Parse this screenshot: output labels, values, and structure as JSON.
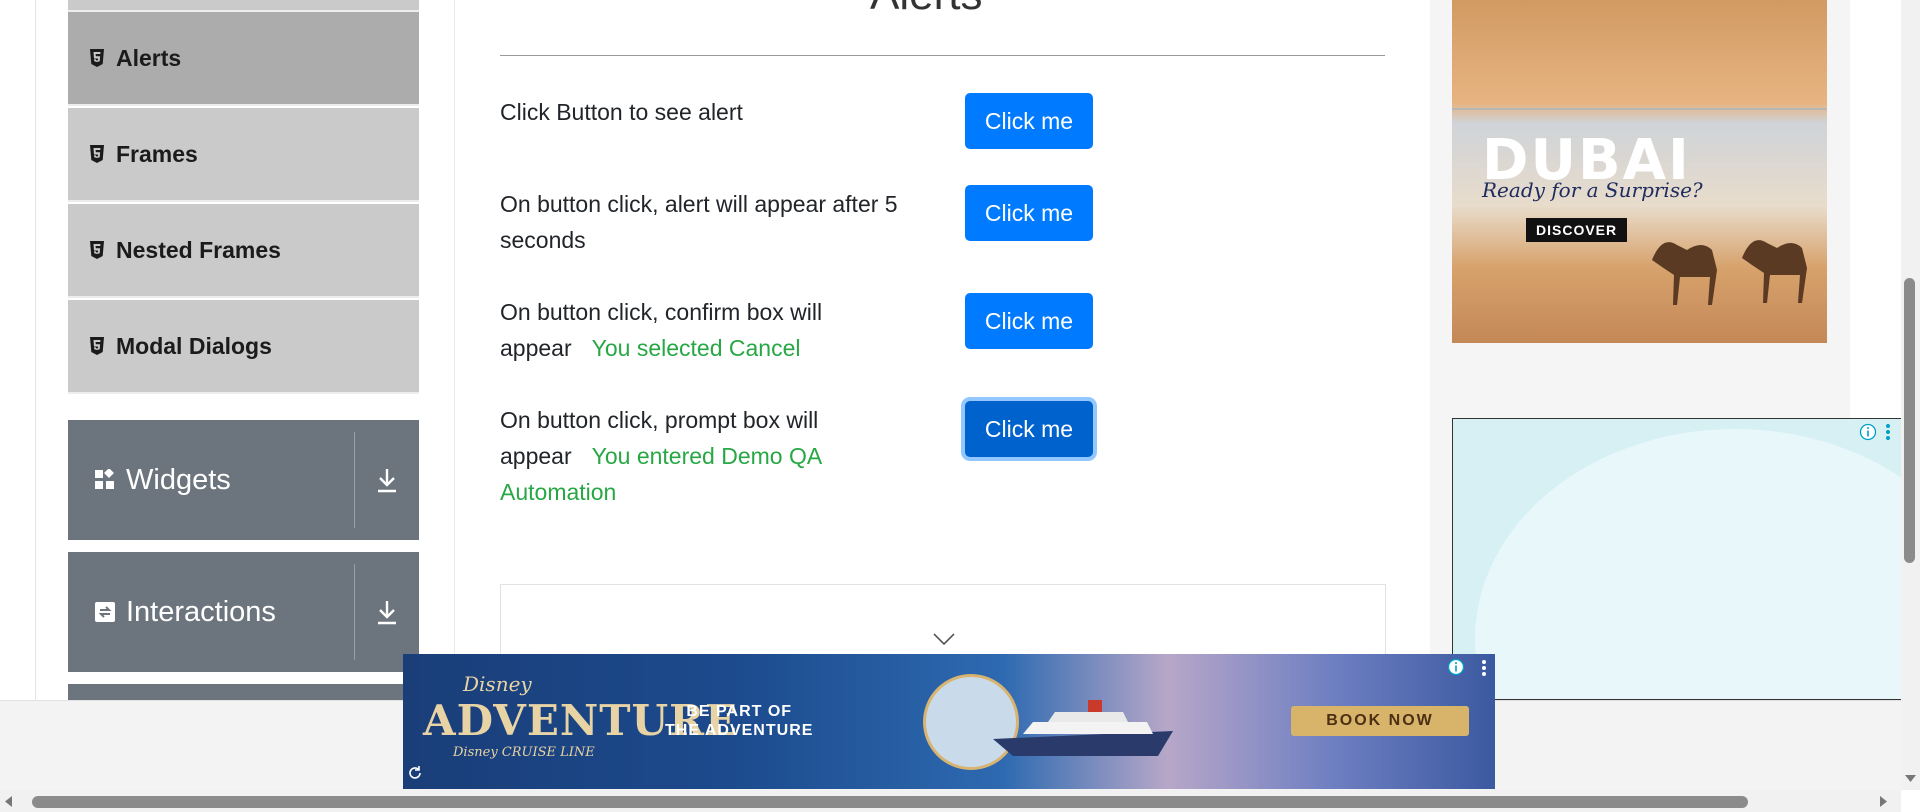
{
  "sidebar": {
    "items": [
      {
        "label": "Alerts",
        "active": true
      },
      {
        "label": "Frames",
        "active": false
      },
      {
        "label": "Nested Frames",
        "active": false
      },
      {
        "label": "Modal Dialogs",
        "active": false
      }
    ],
    "groups": [
      {
        "label": "Widgets",
        "icon": "widgets-icon"
      },
      {
        "label": "Interactions",
        "icon": "interactions-icon"
      }
    ]
  },
  "main": {
    "title": "Alerts",
    "rows": [
      {
        "text": "Click Button to see alert",
        "result": "",
        "button": "Click me"
      },
      {
        "text": "On button click, alert will appear after 5 seconds",
        "result": "",
        "button": "Click me"
      },
      {
        "text": "On button click, confirm box will appear",
        "result": "You selected Cancel",
        "button": "Click me"
      },
      {
        "text": "On button click, prompt box will appear",
        "result": "You entered Demo QA Automation",
        "button": "Click me"
      }
    ]
  },
  "ads": {
    "right_top": {
      "headline": "DUBAI",
      "tagline": "Ready for a Surprise?",
      "cta": "DISCOVER"
    },
    "bottom": {
      "brand_top": "Disney",
      "brand_main": "ADVENTURE",
      "brand_sub": "Disney CRUISE LINE",
      "message_line1": "BE PART OF",
      "message_line2": "THE ADVENTURE",
      "cta": "BOOK NOW"
    }
  },
  "colors": {
    "primary": "#007bff",
    "success": "#28a745",
    "sidebar_group": "#6c757d",
    "sidebar_item": "#cacaca",
    "sidebar_active": "#acacac"
  }
}
